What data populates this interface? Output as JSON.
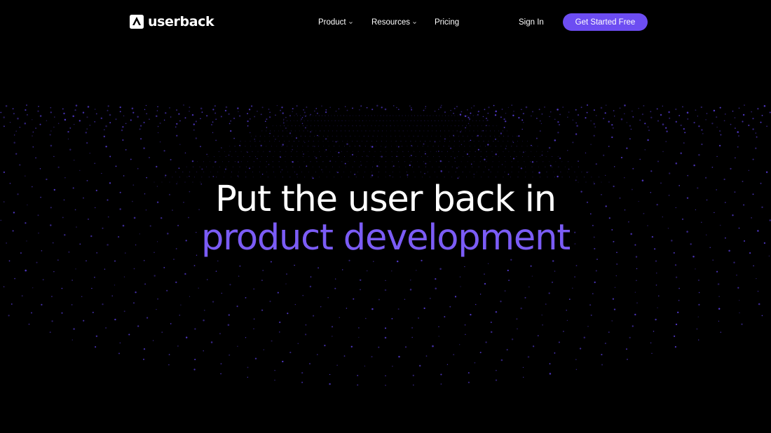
{
  "header": {
    "logo_text": "userback",
    "nav": [
      {
        "label": "Product",
        "has_dropdown": true
      },
      {
        "label": "Resources",
        "has_dropdown": true
      },
      {
        "label": "Pricing",
        "has_dropdown": false
      }
    ],
    "sign_in_label": "Sign In",
    "cta_label": "Get Started Free"
  },
  "hero": {
    "line1": "Put the user back in",
    "line2": "product development"
  },
  "colors": {
    "background": "#000000",
    "accent": "#6d4df2",
    "headline_accent": "#7b5cf6",
    "dot": "#5b3fe0"
  },
  "icons": {
    "logo": "userback-logo-icon",
    "dropdown": "chevron-down-icon",
    "background": "particle-wave-pattern"
  }
}
